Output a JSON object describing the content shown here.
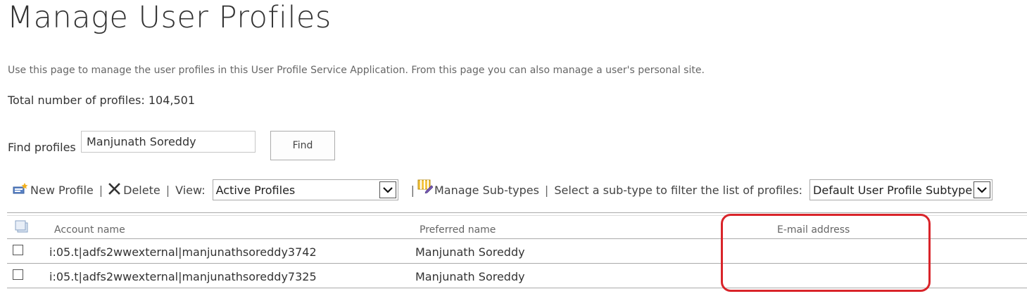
{
  "page": {
    "title": "Manage User Profiles",
    "description": "Use this page to manage the user profiles in this User Profile Service Application. From this page you can also manage a user's personal site.",
    "total_profiles": "Total number of profiles: 104,501"
  },
  "search": {
    "label": "Find profiles",
    "value": "Manjunath Soreddy",
    "button_label": "Find"
  },
  "toolbar": {
    "new_profile_label": "New Profile",
    "delete_label": "Delete",
    "view_label": "View:",
    "view_selected": "Active Profiles",
    "manage_subtypes_label": "Manage Sub-types",
    "subtype_filter_label": "Select a sub-type to filter the list of profiles:",
    "subtype_selected": "Default User Profile Subtype",
    "separator": "|"
  },
  "table": {
    "columns": [
      "Account name",
      "Preferred name",
      "E-mail address"
    ],
    "rows": [
      {
        "account": "i:05.t|adfs2wwexternal|manjunathsoreddy3742",
        "preferred": "Manjunath Soreddy",
        "email": ""
      },
      {
        "account": "i:05.t|adfs2wwexternal|manjunathsoreddy7325",
        "preferred": "Manjunath Soreddy",
        "email": ""
      }
    ]
  },
  "icons": {
    "new_profile": "new-profile-icon",
    "delete": "delete-x-icon",
    "manage_subtypes": "manage-subtypes-icon",
    "select_all": "select-all-icon",
    "dropdown": "chevron-down-icon"
  },
  "colors": {
    "highlight": "#d9242a"
  }
}
